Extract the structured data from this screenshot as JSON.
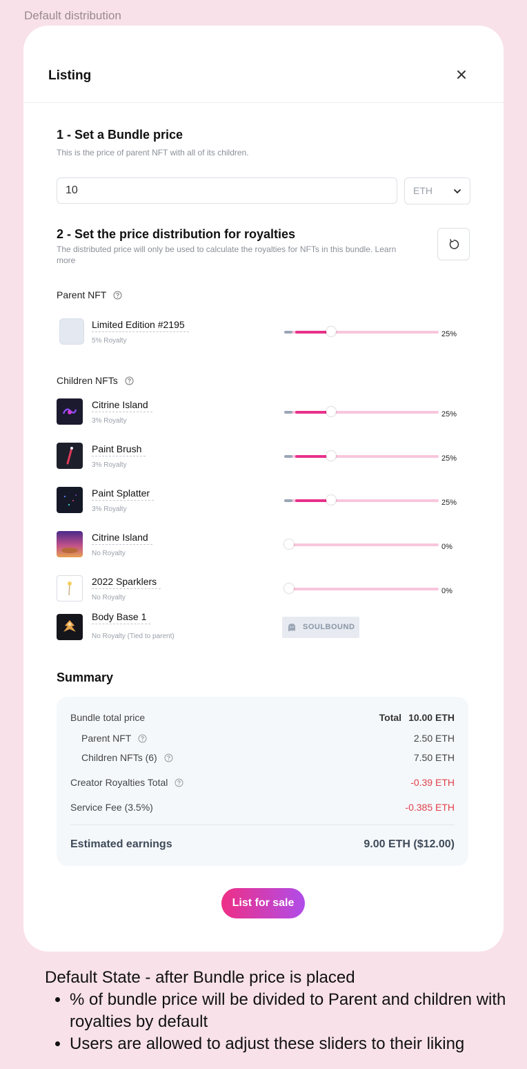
{
  "caption": "Default distribution",
  "modal": {
    "title": "Listing",
    "close_icon": "close-icon"
  },
  "step1": {
    "title": "1 -  Set a Bundle price",
    "subtitle": "This is the price of parent NFT with all of its children.",
    "price_value": "10",
    "currency": "ETH"
  },
  "step2": {
    "title": "2 - Set the price distribution for royalties",
    "subtitle_line1": "The distributed price will only be used to calculate the royalties for NFTs in this bundle. Learn",
    "subtitle_line2": "more",
    "reset_icon": "refresh-icon"
  },
  "parent": {
    "label": "Parent NFT",
    "item": {
      "name": "Limited Edition #2195",
      "royalty": "5% Royalty",
      "percent_label": "25%",
      "value": 25
    }
  },
  "children": {
    "label": "Children NFTs",
    "items": [
      {
        "name": "Citrine Island",
        "royalty": "3% Royalty",
        "percent_label": "25%",
        "value": 25
      },
      {
        "name": "Paint Brush",
        "royalty": "3% Royalty",
        "percent_label": "25%",
        "value": 25
      },
      {
        "name": "Paint Splatter",
        "royalty": "3% Royalty",
        "percent_label": "25%",
        "value": 25
      },
      {
        "name": "Citrine Island",
        "royalty": "No Royalty",
        "percent_label": "0%",
        "value": 0
      },
      {
        "name": "2022 Sparklers",
        "royalty": "No Royalty",
        "percent_label": "0%",
        "value": 0
      },
      {
        "name": "Body Base 1",
        "royalty": "No Royalty (Tied to parent)",
        "badge": "SOULBOUND"
      }
    ]
  },
  "summary": {
    "title": "Summary",
    "bundle_total_label": "Bundle total price",
    "total_label": "Total",
    "total_value": "10.00 ETH",
    "parent_label": "Parent NFT",
    "parent_value": "2.50 ETH",
    "children_label": "Children NFTs (6)",
    "children_value": "7.50 ETH",
    "royalties_label": "Creator Royalties Total",
    "royalties_value": "-0.39 ETH",
    "fee_label": "Service Fee (3.5%)",
    "fee_value": "-0.385 ETH",
    "earnings_label": "Estimated earnings",
    "earnings_value": "9.00 ETH ($12.00)"
  },
  "cta": "List for sale",
  "notes": {
    "heading": "Default State - after Bundle price is placed",
    "bullets": [
      "% of bundle price will be divided to Parent and children with royalties by default",
      "Users are allowed to adjust these sliders to their liking"
    ]
  },
  "colors": {
    "accent": "#e8308a",
    "slider_track": "#f8c6dc",
    "negative": "#e0404a",
    "background": "#f8e1e9"
  }
}
